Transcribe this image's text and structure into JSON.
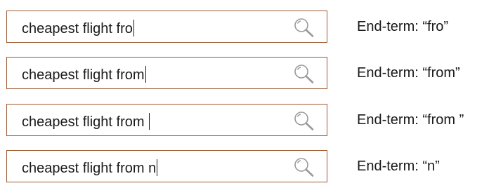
{
  "rows": [
    {
      "query": "cheapest flight fro",
      "end_term": "End-term: “fro”"
    },
    {
      "query": "cheapest flight from",
      "end_term": "End-term: “from”"
    },
    {
      "query": "cheapest flight from ",
      "end_term": "End-term: “from ”"
    },
    {
      "query": "cheapest flight from n",
      "end_term": "End-term: “n”"
    }
  ],
  "colors": {
    "box_border": "#9c5a33",
    "text": "#1a1a1a",
    "icon": "#9a9a9a"
  },
  "icons": {
    "search": "search-icon"
  }
}
